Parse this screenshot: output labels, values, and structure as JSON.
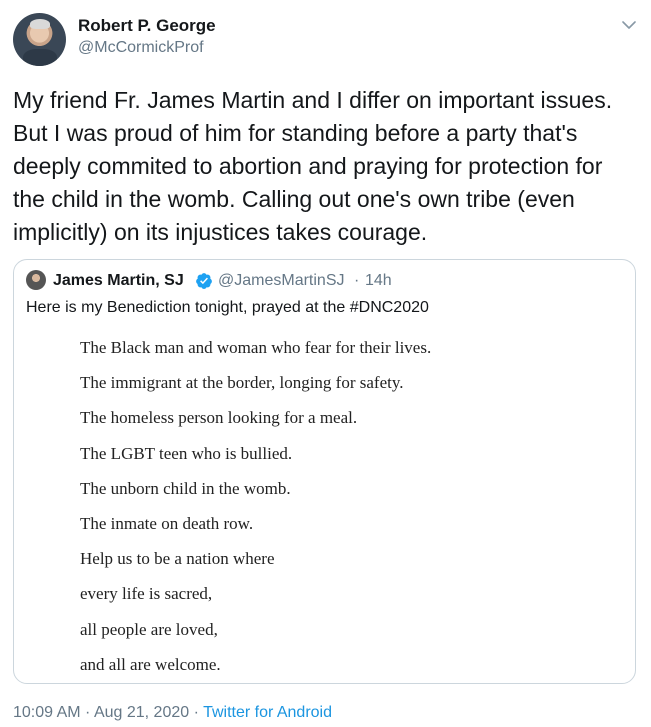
{
  "tweet": {
    "author_name": "Robert P. George",
    "author_handle": "@McCormickProf",
    "text": "My friend Fr. James Martin and I differ on important issues. But I was proud of him for standing before a party that's deeply commited to abortion and praying for protection for the child in the womb. Calling out one's own tribe (even implicitly) on its injustices takes courage.",
    "timestamp": "10:09 AM · Aug 21, 2020 · ",
    "source": "Twitter for Android"
  },
  "quote": {
    "author_name": "James Martin, SJ",
    "author_handle": "@JamesMartinSJ",
    "separator": "·",
    "time": "14h",
    "text": "Here is my Benediction tonight, prayed at the #DNC2020",
    "image_lines": [
      "The Black man and woman who fear for their lives.",
      "The immigrant at the border, longing for safety.",
      "The homeless person looking for a meal.",
      "The LGBT teen who is bullied.",
      "The unborn child in the womb.",
      "The inmate on death row.",
      "Help us to be a nation where",
      "every life is sacred,",
      "all people are loved,",
      "and all are welcome."
    ]
  },
  "icons": {
    "caret": "chevron-down-icon",
    "verified": "verified-badge-icon"
  },
  "colors": {
    "text": "#14171a",
    "secondary": "#657786",
    "link": "#1b95e0",
    "border": "#ccd6dd"
  }
}
